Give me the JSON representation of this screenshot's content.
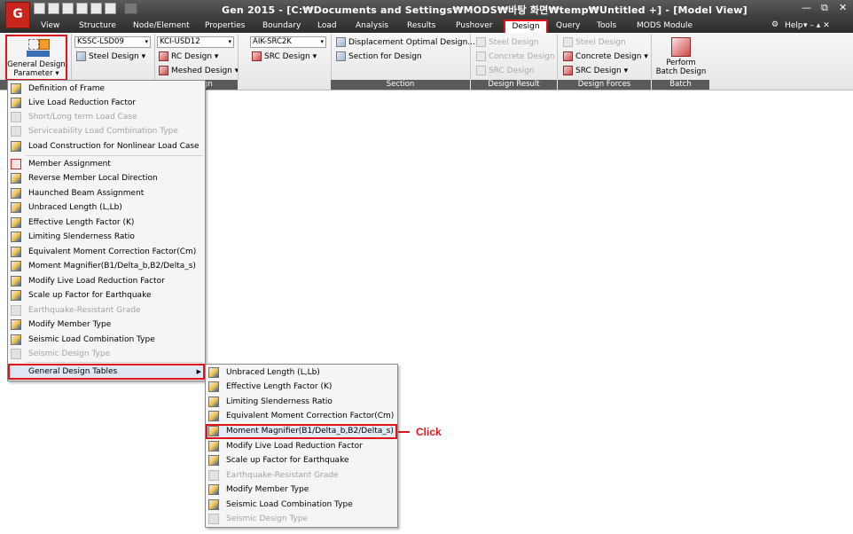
{
  "app": {
    "title": "Gen 2015 - [C:₩Documents and Settings₩MODS₩바탕 화면₩temp₩Untitled +] - [Model View]",
    "logo_text": "G"
  },
  "menubar": {
    "items": [
      "View",
      "Structure",
      "Node/Element",
      "Properties",
      "Boundary",
      "Load",
      "Analysis",
      "Results",
      "Pushover",
      "Design",
      "Query",
      "Tools",
      "MODS Module"
    ],
    "help_label": "Help"
  },
  "ribbon": {
    "gdp_label_line1": "General Design",
    "gdp_label_line2": "Parameter",
    "steel_code": "KSSC-LSD09",
    "rc_code": "KCI-USD12",
    "src_code": "AIK-SRC2K",
    "steel_design": "Steel Design",
    "rc_design": "RC Design",
    "meshed_design": "Meshed Design",
    "src_design": "SRC Design",
    "disp_opt": "Displacement Optimal Design...",
    "section_for_design": "Section for Design",
    "result_steel": "Steel Design",
    "result_concrete": "Concrete Design",
    "result_src": "SRC Design",
    "forces_steel": "Steel Design",
    "forces_concrete": "Concrete Design",
    "forces_src": "SRC Design",
    "perform_batch_line1": "Perform",
    "perform_batch_line2": "Batch Design",
    "groups": [
      "gn",
      "Section",
      "Design Result",
      "Design Forces",
      "Batch"
    ]
  },
  "menu1": {
    "items": [
      {
        "label": "Definition of Frame"
      },
      {
        "label": "Live Load Reduction Factor"
      },
      {
        "label": "Short/Long term Load Case"
      },
      {
        "label": "Serviceability Load Combination Type"
      },
      {
        "label": "Load Construction for Nonlinear Load Case"
      },
      {
        "label": "Member Assignment"
      },
      {
        "label": "Reverse Member Local Direction"
      },
      {
        "label": "Haunched Beam Assignment"
      },
      {
        "label": "Unbraced Length (L,Lb)"
      },
      {
        "label": "Effective Length Factor (K)"
      },
      {
        "label": "Limiting Slenderness Ratio"
      },
      {
        "label": "Equivalent Moment Correction Factor(Cm)"
      },
      {
        "label": "Moment Magnifier(B1/Delta_b,B2/Delta_s)"
      },
      {
        "label": "Modify Live Load Reduction Factor"
      },
      {
        "label": "Scale up Factor for Earthquake"
      },
      {
        "label": "Earthquake-Resistant Grade"
      },
      {
        "label": "Modify Member Type"
      },
      {
        "label": "Seismic Load Combination Type"
      },
      {
        "label": "Seismic Design Type"
      },
      {
        "label": "General Design Tables"
      }
    ]
  },
  "menu2": {
    "items": [
      {
        "label": "Unbraced Length (L,Lb)"
      },
      {
        "label": "Effective Length Factor (K)"
      },
      {
        "label": "Limiting Slenderness Ratio"
      },
      {
        "label": "Equivalent Moment Correction Factor(Cm)"
      },
      {
        "label": "Moment Magnifier(B1/Delta_b,B2/Delta_s)"
      },
      {
        "label": "Modify Live Load Reduction Factor"
      },
      {
        "label": "Scale up Factor for Earthquake"
      },
      {
        "label": "Earthquake-Resistant Grade"
      },
      {
        "label": "Modify Member Type"
      },
      {
        "label": "Seismic Load Combination Type"
      },
      {
        "label": "Seismic Design Type"
      }
    ]
  },
  "annotation": {
    "click_label": "Click"
  },
  "colors": {
    "highlight": "#e0141b",
    "titlebar": "#3a3a3a"
  }
}
